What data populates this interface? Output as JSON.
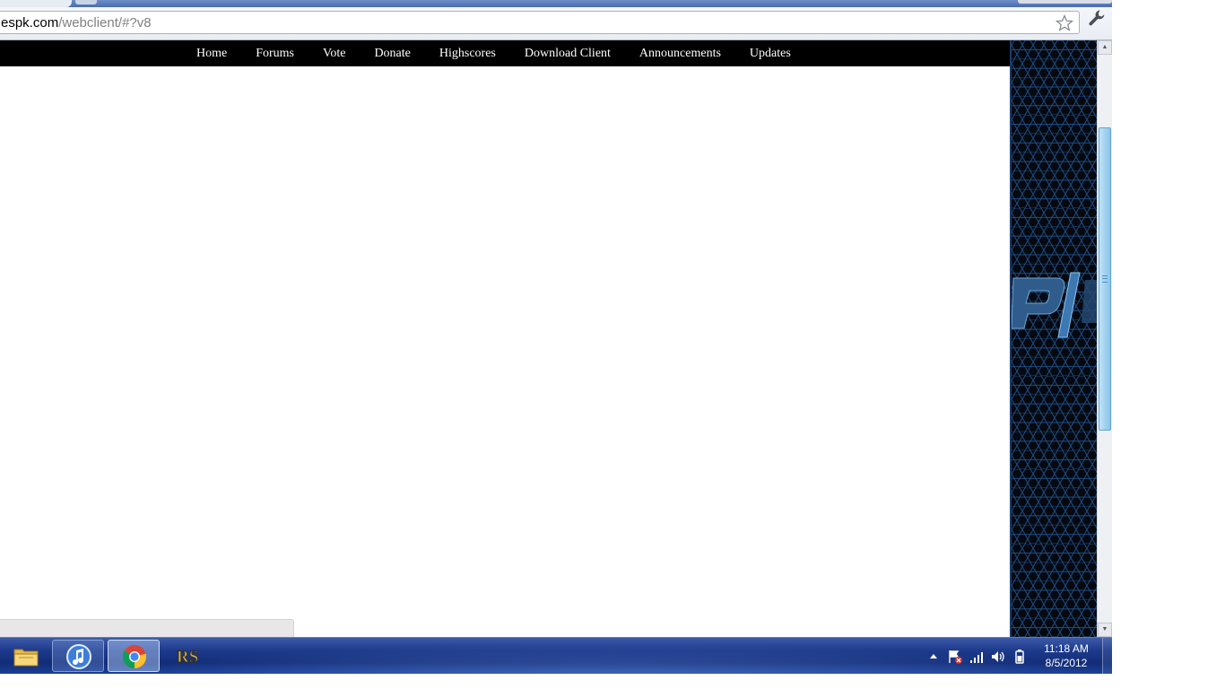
{
  "browser": {
    "url_host": "espk.com",
    "url_path": "/webclient/#?v8",
    "icons": {
      "star": "bookmark-star-icon",
      "wrench": "wrench-menu-icon"
    }
  },
  "nav": {
    "links": [
      {
        "label": "Home"
      },
      {
        "label": "Forums"
      },
      {
        "label": "Vote"
      },
      {
        "label": "Donate"
      },
      {
        "label": "Highscores"
      },
      {
        "label": "Download Client"
      },
      {
        "label": "Announcements"
      },
      {
        "label": "Updates"
      }
    ]
  },
  "taskbar": {
    "apps": [
      {
        "name": "windows-explorer",
        "icon": "folder-icon"
      },
      {
        "name": "itunes",
        "icon": "itunes-icon"
      },
      {
        "name": "google-chrome",
        "icon": "chrome-icon"
      },
      {
        "name": "runescape-client",
        "icon": "rs-icon"
      }
    ],
    "tray_icons": [
      "show-hidden-icons-arrow",
      "action-center-flag-icon",
      "network-signal-icon",
      "volume-icon",
      "power-icon"
    ],
    "clock": {
      "time": "11:18 AM",
      "date": "8/5/2012"
    }
  },
  "colors": {
    "nav_bar": "#000000",
    "nav_text": "#ffffff",
    "taskbar": "#1d3a8c",
    "hex_panel": "#06090f",
    "scroll_thumb": "#9fd0ee"
  }
}
